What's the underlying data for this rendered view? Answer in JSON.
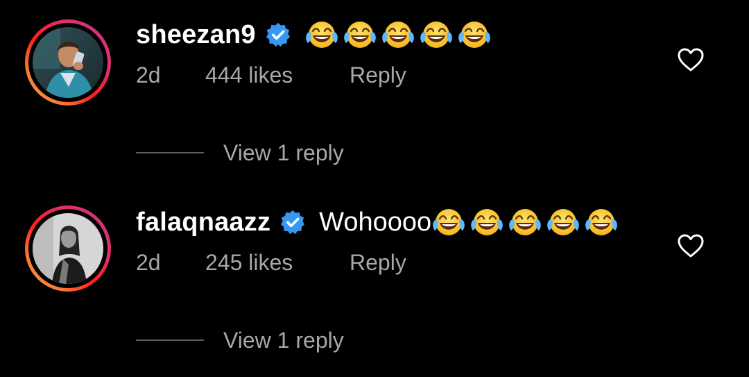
{
  "comments": [
    {
      "username": "sheezan9",
      "verified": true,
      "text": "",
      "emoji_icon": "face-with-tears-of-joy-icon",
      "emoji_count": 5,
      "time": "2d",
      "likes": "444 likes",
      "reply_label": "Reply",
      "view_replies_label": "View 1 reply"
    },
    {
      "username": "falaqnaazz",
      "verified": true,
      "text": "Wohoooo",
      "emoji_icon": "face-with-tears-of-joy-icon",
      "emoji_count": 5,
      "time": "2d",
      "likes": "245 likes",
      "reply_label": "Reply",
      "view_replies_label": "View 1 reply"
    }
  ],
  "colors": {
    "background": "#000000",
    "text_primary": "#ffffff",
    "text_secondary": "#a8a8a8",
    "verified_badge": "#3897f0",
    "story_ring_start": "#fcaf45",
    "story_ring_end": "#c13584"
  },
  "icons": {
    "like": "heart-outline-icon",
    "verified": "verified-badge-icon"
  }
}
